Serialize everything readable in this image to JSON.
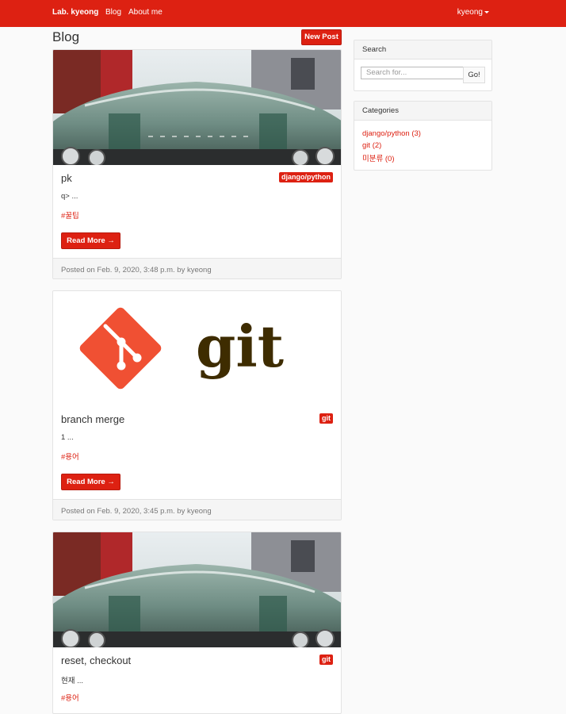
{
  "navbar": {
    "brand": "Lab. kyeong",
    "links": [
      "Blog",
      "About me"
    ],
    "user": "kyeong"
  },
  "page": {
    "title": "Blog",
    "new_post_label": "New Post"
  },
  "posts": [
    {
      "title": "pk",
      "category": "django/python",
      "excerpt": "q> ...",
      "tag": "#꿀팁",
      "read_more": "Read More →",
      "footer": "Posted on Feb. 9, 2020, 3:48 p.m. by kyeong",
      "image": "car-photo"
    },
    {
      "title": "branch merge",
      "category": "git",
      "excerpt": "1 ...",
      "tag": "#용어",
      "read_more": "Read More →",
      "footer": "Posted on Feb. 9, 2020, 3:45 p.m. by kyeong",
      "image": "git-logo",
      "image_text": "git"
    },
    {
      "title": "reset, checkout",
      "category": "git",
      "excerpt": "현재 ...",
      "tag": "#용어",
      "image": "car-photo"
    }
  ],
  "sidebar": {
    "search": {
      "header": "Search",
      "placeholder": "Search for...",
      "button": "Go!"
    },
    "categories": {
      "header": "Categories",
      "items": [
        {
          "name": "django/python",
          "count": "(3)"
        },
        {
          "name": "git",
          "count": "(2)"
        },
        {
          "name": "미분류",
          "count": "(0)"
        }
      ]
    }
  },
  "colors": {
    "accent": "#dd2112",
    "git_orange": "#f05033",
    "git_text": "#3e2c00"
  }
}
